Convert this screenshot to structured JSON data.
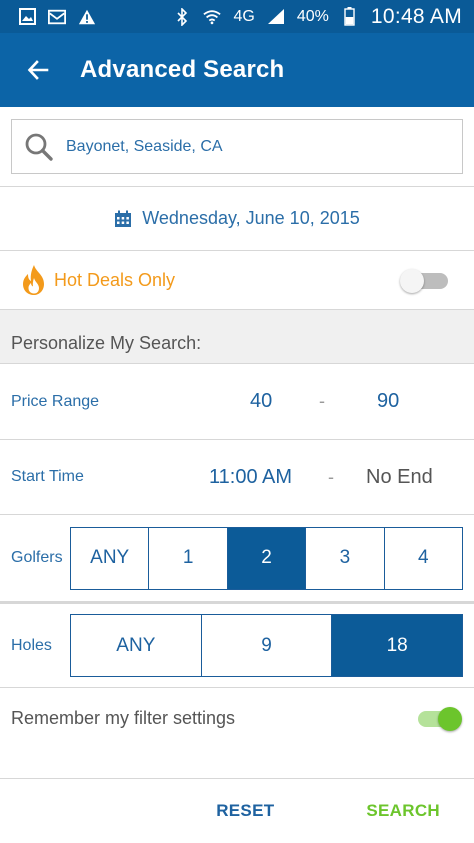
{
  "status_bar": {
    "network": "4G",
    "battery": "40%",
    "time": "10:48 AM",
    "icons": [
      "image-icon",
      "mail-icon",
      "warning-icon",
      "bluetooth-icon",
      "wifi-icon",
      "signal-icon",
      "battery-icon"
    ]
  },
  "app_bar": {
    "title": "Advanced Search"
  },
  "search": {
    "value": "Bayonet, Seaside, CA"
  },
  "date": {
    "label": "Wednesday, June 10, 2015"
  },
  "hot_deals": {
    "label": "Hot Deals Only",
    "enabled": false
  },
  "personalize": {
    "header": "Personalize My Search:",
    "price_range": {
      "label": "Price Range",
      "min": "40",
      "separator": "-",
      "max": "90"
    },
    "start_time": {
      "label": "Start Time",
      "from": "11:00 AM",
      "separator": "-",
      "to": "No End"
    },
    "golfers": {
      "label": "Golfers",
      "options": [
        "ANY",
        "1",
        "2",
        "3",
        "4"
      ],
      "selected": "2"
    },
    "holes": {
      "label": "Holes",
      "options": [
        "ANY",
        "9",
        "18"
      ],
      "selected": "18"
    }
  },
  "remember": {
    "label": "Remember my filter settings",
    "enabled": true
  },
  "footer": {
    "reset_label": "RESET",
    "search_label": "SEARCH"
  },
  "colors": {
    "primary": "#0c64a7",
    "accent_green": "#6cc52c",
    "hot_orange": "#f39a1b",
    "text_blue": "#2b6ea8"
  }
}
